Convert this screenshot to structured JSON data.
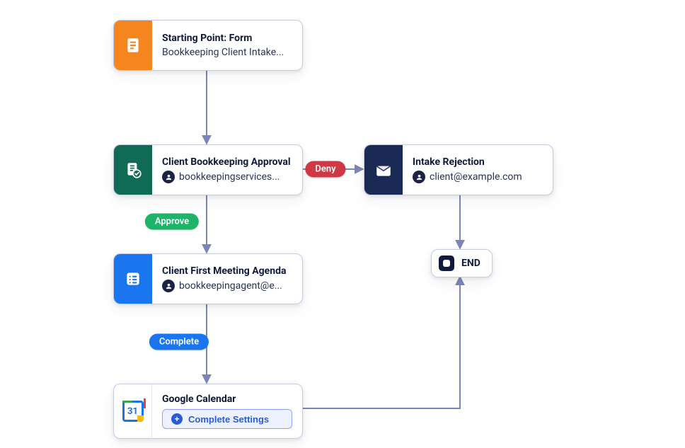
{
  "colors": {
    "connector": "#7b86b8",
    "orange": "#f5851f",
    "teal": "#0f6b55",
    "blue": "#1976f0",
    "navy": "#1b2a55",
    "approve": "#1db46a",
    "deny": "#cf3845",
    "complete": "#1976f0"
  },
  "nodes": {
    "start": {
      "title": "Starting Point: Form",
      "subtitle": "Bookkeeping Client Intake..."
    },
    "approval": {
      "title": "Client Bookkeeping Approval",
      "assignee": "bookkeepingservices..."
    },
    "agenda": {
      "title": "Client First Meeting Agenda",
      "assignee": "bookkeepingagent@e..."
    },
    "gcal": {
      "title": "Google Calendar",
      "day": "31",
      "settings_label": "Complete Settings"
    },
    "rejection": {
      "title": "Intake Rejection",
      "assignee": "client@example.com"
    },
    "end": {
      "label": "END"
    }
  },
  "edges": {
    "approve": "Approve",
    "deny": "Deny",
    "complete": "Complete"
  }
}
